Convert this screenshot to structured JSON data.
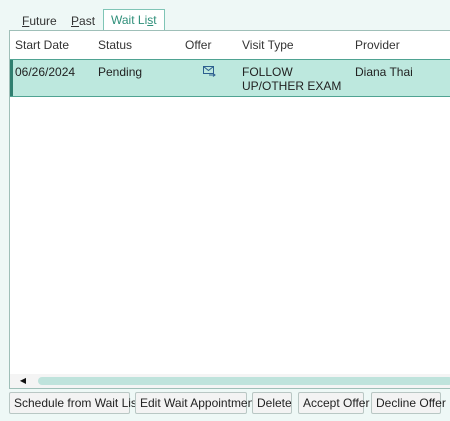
{
  "tabs": {
    "future_pre": "",
    "future_u": "F",
    "future_post": "uture",
    "past_pre": "",
    "past_u": "P",
    "past_post": "ast",
    "waitlist_pre": "Wait Li",
    "waitlist_u": "s",
    "waitlist_post": "t"
  },
  "table": {
    "headers": {
      "start_date": "Start Date",
      "status": "Status",
      "offer": "Offer",
      "visit_type": "Visit Type",
      "provider": "Provider"
    },
    "rows": [
      {
        "start_date": "06/26/2024",
        "status": "Pending",
        "offer_icon": "envelope-arrow-icon",
        "visit_type_line1": "FOLLOW",
        "visit_type_line2": "UP/OTHER EXAM",
        "provider": "Diana Thai"
      }
    ]
  },
  "buttons": {
    "schedule": "Schedule from Wait List",
    "edit": "Edit Wait Appointment",
    "delete": "Delete",
    "accept": "Accept Offer",
    "decline": "Decline Offer"
  },
  "colors": {
    "accent": "#2f8f7a",
    "selected_row": "#bde8de",
    "background": "#eef8f6"
  }
}
